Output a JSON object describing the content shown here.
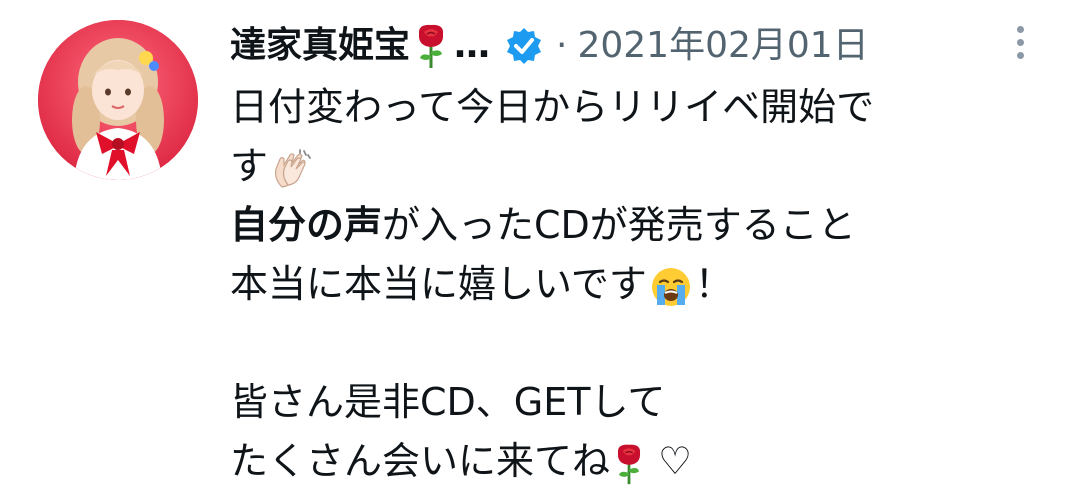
{
  "tweet": {
    "display_name": "達家真姫宝",
    "ellipsis": "…",
    "separator": "·",
    "date": "2021年02月01日",
    "icons": {
      "name_emoji": "rose-icon",
      "verified": "verified-badge-icon",
      "more": "more-options-icon"
    },
    "colors": {
      "verified": "#1d9bf0",
      "secondary_text": "#536471",
      "rose": "#c8102e"
    },
    "lines": {
      "l1": "日付変わって今日からリリイベ開始で",
      "l2": "す",
      "l3_bold": "自分の声",
      "l3_rest": "が入ったCDが発売すること",
      "l4": "本当に本当に嬉しいです",
      "l4_end": "！",
      "l5": "皆さん是非CD、GETして",
      "l6": "たくさん会いに来てね",
      "l6_end": "♡"
    },
    "emoji_names": {
      "clap": "clapping-hands-icon",
      "cry": "loudly-crying-face-icon",
      "rose": "rose-icon"
    }
  }
}
